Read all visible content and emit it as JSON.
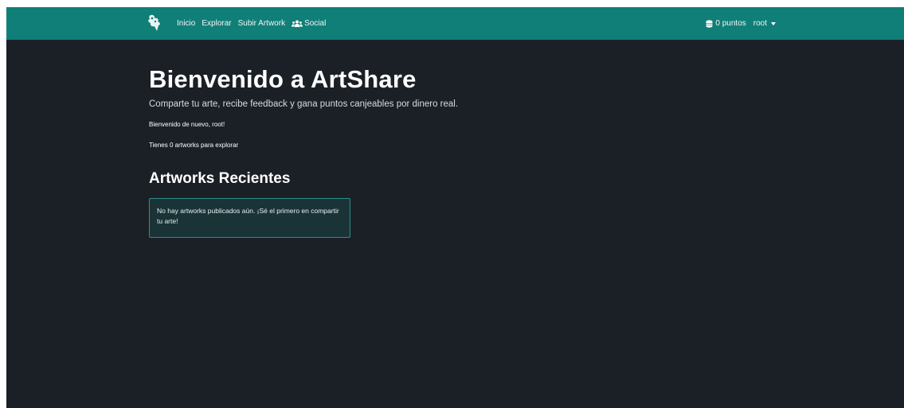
{
  "navbar": {
    "brand_icon": "brand-logo-icon",
    "links": [
      {
        "label": "Inicio"
      },
      {
        "label": "Explorar"
      },
      {
        "label": "Subir Artwork"
      },
      {
        "label": "Social",
        "icon": "users-icon"
      }
    ],
    "points_label": "0 puntos",
    "points_icon": "coins-icon",
    "username": "root"
  },
  "hero": {
    "title": "Bienvenido a ArtShare",
    "subtitle": "Comparte tu arte, recibe feedback y gana puntos canjeables por dinero real.",
    "welcome_text": "Bienvenido de nuevo, root!",
    "artworks_count_text": "Tienes 0 artworks para explorar"
  },
  "recent": {
    "title": "Artworks Recientes",
    "empty_message": "No hay artworks publicados aún. ¡Sé el primero en compartir tu arte!"
  },
  "colors": {
    "navbar_bg": "#107f78",
    "page_bg": "#1b2027",
    "alert_bg": "#1a3337",
    "alert_border": "#2d8f8c"
  }
}
